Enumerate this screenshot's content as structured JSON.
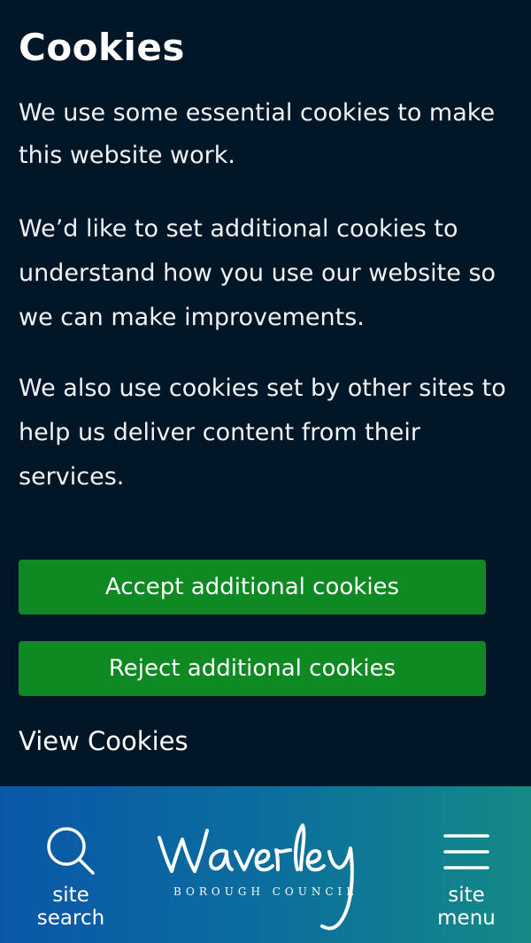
{
  "cookie_banner": {
    "title": "Cookies",
    "paragraphs": [
      "We use some essential cookies to make this website work.",
      "We’d like to set additional cookies to understand how you use our website so we can make improvements.",
      "We also use cookies set by other sites to help us deliver content from their services."
    ],
    "accept_label": "Accept additional cookies",
    "reject_label": "Reject additional cookies",
    "view_label": "View Cookies"
  },
  "header": {
    "search_label_line1": "site",
    "search_label_line2": "search",
    "menu_label_line1": "site",
    "menu_label_line2": "menu",
    "logo_text": "Waverley",
    "logo_subtext": "BOROUGH COUNCIL"
  },
  "colors": {
    "banner_bg": "#011627",
    "button_green": "#0f8a23",
    "header_gradient_start": "#0a57a8",
    "header_gradient_end": "#148a86"
  },
  "icons": [
    "search-icon",
    "hamburger-menu-icon",
    "waverley-logo"
  ]
}
